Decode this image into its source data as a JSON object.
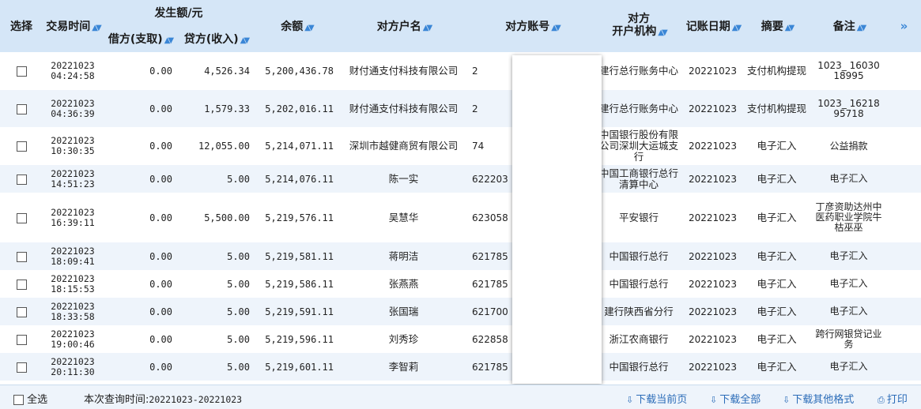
{
  "header": {
    "select": "选择",
    "time": "交易时间",
    "amount_group": "发生额/元",
    "debit": "借方(支取)",
    "credit": "贷方(收入)",
    "balance": "余额",
    "party_name": "对方户名",
    "party_account": "对方账号",
    "party_bank_l1": "对方",
    "party_bank_l2": "开户机构",
    "date": "记账日期",
    "summary": "摘要",
    "remark": "备注",
    "next": "»"
  },
  "rows": [
    {
      "date": "20221023",
      "time": "04:24:58",
      "debit": "0.00",
      "credit": "4,526.34",
      "balance": "5,200,436.78",
      "name": "财付通支付科技有限公司",
      "account": "2",
      "bank": "建行总行账务中心",
      "post_date": "20221023",
      "summary": "支付机构提现",
      "remark": "1023_ 16030 18995"
    },
    {
      "date": "20221023",
      "time": "04:36:39",
      "debit": "0.00",
      "credit": "1,579.33",
      "balance": "5,202,016.11",
      "name": "财付通支付科技有限公司",
      "account": "2",
      "bank": "建行总行账务中心",
      "post_date": "20221023",
      "summary": "支付机构提现",
      "remark": "1023_ 16218 95718"
    },
    {
      "date": "20221023",
      "time": "10:30:35",
      "debit": "0.00",
      "credit": "12,055.00",
      "balance": "5,214,071.11",
      "name": "深圳市越健商贸有限公司",
      "account": "74",
      "bank": "中国银行股份有限公司深圳大运城支行",
      "post_date": "20221023",
      "summary": "电子汇入",
      "remark": "公益捐款"
    },
    {
      "date": "20221023",
      "time": "14:51:23",
      "debit": "0.00",
      "credit": "5.00",
      "balance": "5,214,076.11",
      "name": "陈一实",
      "account": "622203",
      "bank": "中国工商银行总行清算中心",
      "post_date": "20221023",
      "summary": "电子汇入",
      "remark": "电子汇入"
    },
    {
      "date": "20221023",
      "time": "16:39:11",
      "debit": "0.00",
      "credit": "5,500.00",
      "balance": "5,219,576.11",
      "name": "吴慧华",
      "account": "623058",
      "bank": "平安银行",
      "post_date": "20221023",
      "summary": "电子汇入",
      "remark": "丁彦资助达州中医药职业学院牛枯巫巫"
    },
    {
      "date": "20221023",
      "time": "18:09:41",
      "debit": "0.00",
      "credit": "5.00",
      "balance": "5,219,581.11",
      "name": "蒋明洁",
      "account": "621785",
      "bank": "中国银行总行",
      "post_date": "20221023",
      "summary": "电子汇入",
      "remark": "电子汇入"
    },
    {
      "date": "20221023",
      "time": "18:15:53",
      "debit": "0.00",
      "credit": "5.00",
      "balance": "5,219,586.11",
      "name": "张燕燕",
      "account": "621785",
      "bank": "中国银行总行",
      "post_date": "20221023",
      "summary": "电子汇入",
      "remark": "电子汇入"
    },
    {
      "date": "20221023",
      "time": "18:33:58",
      "debit": "0.00",
      "credit": "5.00",
      "balance": "5,219,591.11",
      "name": "张国瑞",
      "account": "621700",
      "bank": "建行陕西省分行",
      "post_date": "20221023",
      "summary": "电子汇入",
      "remark": "电子汇入"
    },
    {
      "date": "20221023",
      "time": "19:00:46",
      "debit": "0.00",
      "credit": "5.00",
      "balance": "5,219,596.11",
      "name": "刘秀珍",
      "account": "622858",
      "bank": "浙江农商银行",
      "post_date": "20221023",
      "summary": "电子汇入",
      "remark": "跨行网银贷记业务"
    },
    {
      "date": "20221023",
      "time": "20:11:30",
      "debit": "0.00",
      "credit": "5.00",
      "balance": "5,219,601.11",
      "name": "李智莉",
      "account": "621785",
      "bank": "中国银行总行",
      "post_date": "20221023",
      "summary": "电子汇入",
      "remark": "电子汇入"
    }
  ],
  "footer": {
    "select_all": "全选",
    "query_label": "本次查询时间:",
    "query_range": "20221023-20221023",
    "download_page": "下载当前页",
    "download_all": "下载全部",
    "download_other": "下载其他格式",
    "print": "打印"
  }
}
